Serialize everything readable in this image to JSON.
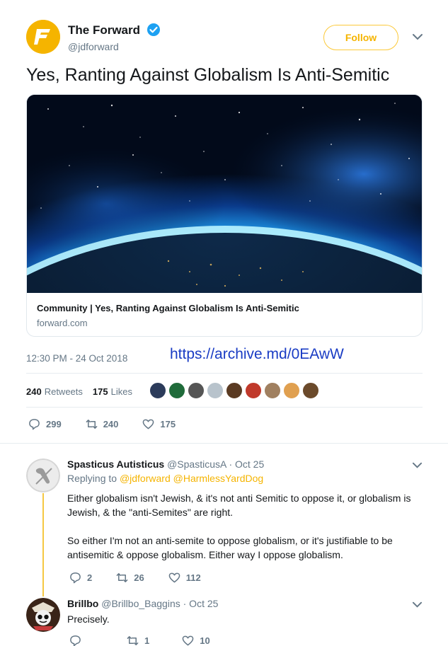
{
  "tweet": {
    "author_name": "The Forward",
    "author_handle": "@jdforward",
    "follow_label": "Follow",
    "text": "Yes, Ranting Against Globalism Is Anti-Semitic",
    "card": {
      "title": "Community | Yes, Ranting Against Globalism Is Anti-Semitic",
      "domain": "forward.com"
    },
    "timestamp": "12:30 PM - 24 Oct 2018",
    "overlay_link": "https://archive.md/0EAwW",
    "retweets_count": "240",
    "retweets_label": "Retweets",
    "likes_count": "175",
    "likes_label": "Likes",
    "actions": {
      "replies": "299",
      "retweets": "240",
      "likes": "175"
    },
    "liker_avatar_colors": [
      "#2b3b5a",
      "#1f6b3a",
      "#555555",
      "#b8c3cc",
      "#5a3a22",
      "#c0392b",
      "#a08060",
      "#e0a050",
      "#6b4a2b"
    ]
  },
  "replies": [
    {
      "name": "Spasticus Autisticus",
      "handle": "@SpasticusA",
      "date": "· Oct 25",
      "replying_label": "Replying to",
      "replying_to": "@jdforward @HarmlessYardDog",
      "text_lines": [
        "Either globalism isn't Jewish, & it's not anti Semitic to oppose it, or globalism is",
        "Jewish, & the \"anti-Semites\" are right.",
        "So either I'm not an anti-semite to oppose globalism, or it's justifiable to be",
        "antisemitic & oppose globalism. Either way I oppose globalism."
      ],
      "actions": {
        "replies": "2",
        "retweets": "26",
        "likes": "112"
      }
    },
    {
      "name": "Brillbo",
      "handle": "@Brillbo_Baggins",
      "date": "· Oct 25",
      "text": "Precisely.",
      "actions": {
        "replies": "",
        "retweets": "1",
        "likes": "10"
      }
    }
  ],
  "colors": {
    "accent": "#f5b400",
    "link": "#1a3cc4",
    "muted": "#657786",
    "verified": "#1da1f2"
  }
}
